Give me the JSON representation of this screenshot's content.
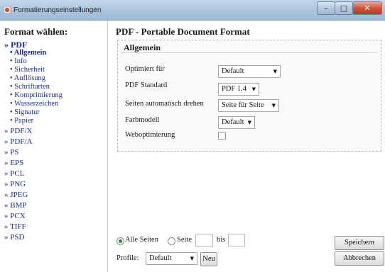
{
  "window": {
    "title": "Formatierungseinstellungen",
    "controls": {
      "minimize": "–",
      "maximize": "□",
      "close": "✕"
    }
  },
  "sidebar": {
    "heading": "Format wählen:",
    "formats": [
      {
        "label": "» PDF",
        "active": true
      },
      {
        "label": "» PDF/X"
      },
      {
        "label": "» PDF/A"
      },
      {
        "label": "» PS"
      },
      {
        "label": "» EPS"
      },
      {
        "label": "» PCL"
      },
      {
        "label": "» PNG"
      },
      {
        "label": "» JPEG"
      },
      {
        "label": "» BMP"
      },
      {
        "label": "» PCX"
      },
      {
        "label": "» TIFF"
      },
      {
        "label": "» PSD"
      }
    ],
    "pdf_subitems": [
      {
        "label": "• Allgemein",
        "active": true
      },
      {
        "label": "• Info"
      },
      {
        "label": "• Sicherheit"
      },
      {
        "label": "• Auflösung"
      },
      {
        "label": "• Schriftarten"
      },
      {
        "label": "• Komprimierung"
      },
      {
        "label": "• Wasserzeichen"
      },
      {
        "label": "• Signatur"
      },
      {
        "label": "• Papier"
      }
    ]
  },
  "main": {
    "title": "PDF - Portable Document Format",
    "section_title": "Allgemein",
    "fields": {
      "optimized_for": {
        "label": "Optimiert für",
        "value": "Default"
      },
      "pdf_standard": {
        "label": "PDF Standard",
        "value": "PDF 1.4"
      },
      "auto_rotate": {
        "label": "Seiten automatisch drehen",
        "value": "Seite für Seite"
      },
      "color_model": {
        "label": "Farbmodell",
        "value": "Default"
      },
      "web_optimization": {
        "label": "Weboptimierung",
        "checked": false
      }
    }
  },
  "footer": {
    "all_pages_label": "Alle Seiten",
    "page_label": "Seite",
    "to_label": "bis",
    "profile_label": "Profile:",
    "profile_value": "Default",
    "new_button": "Neu",
    "save_button": "Speichern",
    "cancel_button": "Abbrechen"
  },
  "colors": {
    "link": "#1c2f86",
    "title_bar": "#a9c3dc",
    "close_button": "#c23a22"
  }
}
